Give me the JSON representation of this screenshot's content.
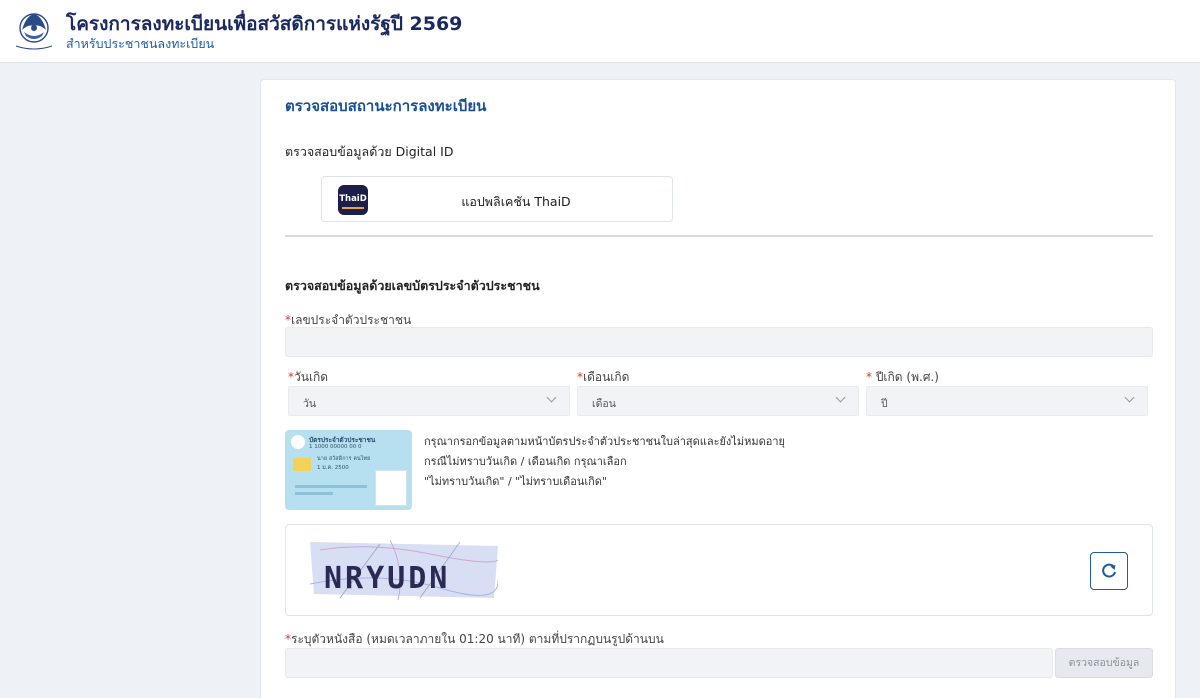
{
  "header": {
    "title": "โครงการลงทะเบียนเพื่อสวัสดิการแห่งรัฐปี 2569",
    "subtitle": "สำหรับประชาชนลงทะเบียน",
    "logo_text": "กระทรวงการคลัง"
  },
  "main": {
    "title": "ตรวจสอบสถานะการลงทะเบียน",
    "digital_id_label": "ตรวจสอบข้อมูลด้วย Digital ID",
    "thaid_button": {
      "logo_text": "ThaiD",
      "label": "แอปพลิเคชัน ThaiD"
    },
    "id_section_label": "ตรวจสอบข้อมูลด้วยเลขบัตรประจำตัวประชาชน",
    "required_mark": "*",
    "id_field": {
      "label": "เลขประจำตัวประชาชน",
      "value": ""
    },
    "day": {
      "label": "วันเกิด",
      "value": "วัน"
    },
    "month": {
      "label": "เดือนเกิด",
      "value": "เดือน"
    },
    "year": {
      "label": " ปีเกิด (พ.ศ.)",
      "value": "ปี"
    },
    "sample_card": {
      "title": "บัตรประจำตัวประชาชน",
      "number": "1 1000 00000 00 0",
      "name": "นาย สวัสดิการ คนไทย",
      "dob": "1 ม.ค. 2500"
    },
    "instructions": [
      "กรุณากรอกข้อมูลตามหน้าบัตรประจำตัวประชาชนใบล่าสุดและยังไม่หมดอายุ",
      "กรณีไม่ทราบวันเกิด / เดือนเกิด กรุณาเลือก",
      "\"ไม่ทราบวันเกิด\" / \"ไม่ทราบเดือนเกิด\""
    ],
    "captcha": {
      "text": "NRYUDN",
      "refresh_icon": "refresh-icon"
    },
    "captcha_input": {
      "label": "ระบุตัวหนังสือ (หมดเวลาภายใน 01:20 นาที) ตามที่ปรากฏบนรูปด้านบน",
      "value": ""
    },
    "submit_label": "ตรวจสอบข้อมูล"
  },
  "colors": {
    "title_navy": "#1a2a5e",
    "accent_blue": "#1a4f96",
    "required_red": "#d9372b",
    "page_bg": "#eef1f6"
  }
}
